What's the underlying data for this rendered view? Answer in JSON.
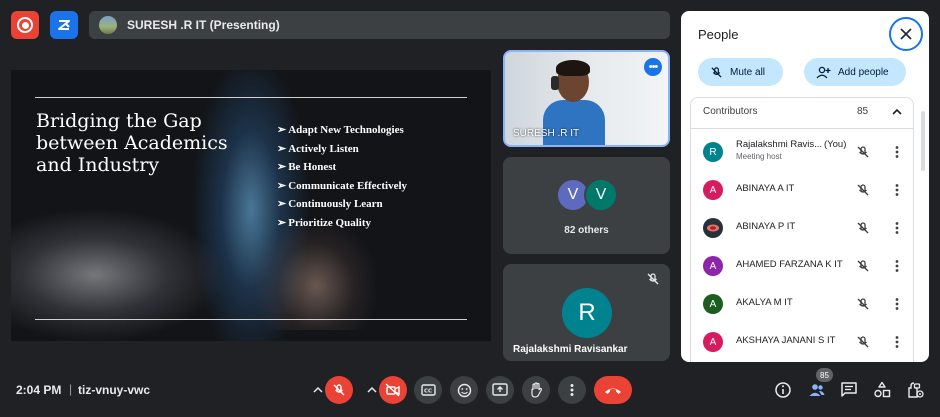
{
  "top_bar": {
    "record_icon": "record-icon",
    "whiteboard_icon": "whiteboard-icon",
    "presenter_label": "SURESH .R IT (Presenting)"
  },
  "slide": {
    "title": "Bridging the Gap between Academics and Industry",
    "bullet_glyph": "➢",
    "bullets": [
      "Adapt New Technologies",
      "Actively Listen",
      "Be Honest",
      "Communicate Effectively",
      "Continuously Learn",
      "Prioritize Quality"
    ]
  },
  "tiles": {
    "presenter": {
      "name": "SURESH .R IT",
      "more_icon": "more-options-icon"
    },
    "others": {
      "avatars": [
        "V",
        "V"
      ],
      "label": "82 others"
    },
    "self": {
      "initial": "R",
      "name": "Rajalakshmi Ravisankar",
      "mic_icon": "mic-off-icon"
    }
  },
  "people_panel": {
    "title": "People",
    "close_icon": "close-icon",
    "mute_all_label": "Mute all",
    "add_people_label": "Add people",
    "contributors_label": "Contributors",
    "contributors_count": "85",
    "participants": [
      {
        "initial": "R",
        "name": "Rajalakshmi Ravis...",
        "you": "(You)",
        "sub": "Meeting host",
        "color": "#00838f"
      },
      {
        "initial": "A",
        "name": "ABINAYA A IT",
        "color": "#d81b60"
      },
      {
        "initial": "",
        "name": "ABINAYA P IT",
        "color": "#263238"
      },
      {
        "initial": "A",
        "name": "AHAMED FARZANA K IT",
        "color": "#8e24aa"
      },
      {
        "initial": "A",
        "name": "AKALYA M IT",
        "color": "#1b5e20"
      },
      {
        "initial": "A",
        "name": "AKSHAYA JANANI S IT",
        "color": "#d81b60"
      }
    ]
  },
  "bottom_bar": {
    "time": "2:04 PM",
    "separator": "|",
    "meeting_code": "tiz-vnuy-vwc",
    "people_badge": "85"
  },
  "colors": {
    "accent": "#1a73e8",
    "danger": "#ea4335",
    "surface": "#3c4043",
    "background": "#202124"
  }
}
